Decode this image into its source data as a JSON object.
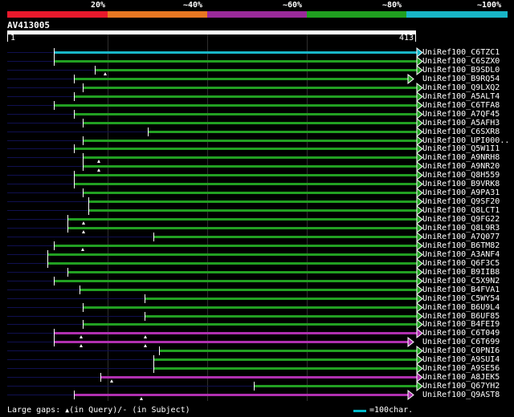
{
  "header": {
    "scale_labels": [
      "20%",
      "~40%",
      "~60%",
      "~80%",
      "~100%"
    ],
    "scale_colors": [
      "#e8192c",
      "#e87722",
      "#9b2a9b",
      "#20a020",
      "#18b6c8"
    ]
  },
  "query": {
    "name": "AV413005",
    "start": "1",
    "end": "413"
  },
  "colors": {
    "cyan": "#18b6c8",
    "green": "#22a022",
    "magenta": "#b030b0",
    "navy": "#101050",
    "white": "#ffffff"
  },
  "hits": [
    {
      "name": "UniRef100_C6TZC1",
      "color": "cyan",
      "start": 67,
      "end": 519,
      "markers": []
    },
    {
      "name": "UniRef100_C6SZX0",
      "color": "green",
      "start": 67,
      "end": 519,
      "markers": []
    },
    {
      "name": "UniRef100_B9SDL0",
      "color": "green",
      "start": 118,
      "end": 519,
      "markers": [
        131
      ]
    },
    {
      "name": "UniRef100_B9RQ54",
      "color": "green",
      "start": 92,
      "end": 508,
      "markers": []
    },
    {
      "name": "UniRef100_Q9LXQ2",
      "color": "green",
      "start": 103,
      "end": 519,
      "markers": []
    },
    {
      "name": "UniRef100_A5ALT4",
      "color": "green",
      "start": 92,
      "end": 519,
      "markers": []
    },
    {
      "name": "UniRef100_C6TFA8",
      "color": "green",
      "start": 67,
      "end": 519,
      "markers": []
    },
    {
      "name": "UniRef100_A7QF45",
      "color": "green",
      "start": 92,
      "end": 519,
      "markers": []
    },
    {
      "name": "UniRef100_A5AFH3",
      "color": "green",
      "start": 103,
      "end": 519,
      "markers": []
    },
    {
      "name": "UniRef100_C6SXR8",
      "color": "green",
      "start": 184,
      "end": 519,
      "markers": []
    },
    {
      "name": "UniRef100_UPI000..",
      "color": "green",
      "start": 103,
      "end": 519,
      "markers": []
    },
    {
      "name": "UniRef100_Q5W1I1",
      "color": "green",
      "start": 92,
      "end": 519,
      "markers": []
    },
    {
      "name": "UniRef100_A9NRH8",
      "color": "green",
      "start": 103,
      "end": 519,
      "markers": [
        123
      ]
    },
    {
      "name": "UniRef100_A9NR20",
      "color": "green",
      "start": 103,
      "end": 519,
      "markers": [
        123
      ]
    },
    {
      "name": "UniRef100_Q8H559",
      "color": "green",
      "start": 92,
      "end": 519,
      "markers": []
    },
    {
      "name": "UniRef100_B9VRK8",
      "color": "green",
      "start": 92,
      "end": 519,
      "markers": []
    },
    {
      "name": "UniRef100_A9PA31",
      "color": "green",
      "start": 103,
      "end": 519,
      "markers": []
    },
    {
      "name": "UniRef100_Q9SF20",
      "color": "green",
      "start": 110,
      "end": 519,
      "markers": []
    },
    {
      "name": "UniRef100_Q8LCT1",
      "color": "green",
      "start": 110,
      "end": 519,
      "markers": []
    },
    {
      "name": "UniRef100_Q9FG22",
      "color": "green",
      "start": 84,
      "end": 519,
      "markers": [
        104
      ]
    },
    {
      "name": "UniRef100_Q8L9R3",
      "color": "green",
      "start": 84,
      "end": 519,
      "markers": [
        104
      ]
    },
    {
      "name": "UniRef100_A7Q077",
      "color": "green",
      "start": 191,
      "end": 519,
      "markers": []
    },
    {
      "name": "UniRef100_B6TM82",
      "color": "green",
      "start": 67,
      "end": 519,
      "markers": [
        103
      ]
    },
    {
      "name": "UniRef100_A3ANF4",
      "color": "green",
      "start": 59,
      "end": 519,
      "markers": []
    },
    {
      "name": "UniRef100_Q6F3C5",
      "color": "green",
      "start": 59,
      "end": 519,
      "markers": []
    },
    {
      "name": "UniRef100_B9IIB8",
      "color": "green",
      "start": 84,
      "end": 519,
      "markers": []
    },
    {
      "name": "UniRef100_C5X9N2",
      "color": "green",
      "start": 67,
      "end": 519,
      "markers": []
    },
    {
      "name": "UniRef100_B4FVA1",
      "color": "green",
      "start": 99,
      "end": 519,
      "markers": []
    },
    {
      "name": "UniRef100_C5WY54",
      "color": "green",
      "start": 180,
      "end": 519,
      "markers": []
    },
    {
      "name": "UniRef100_B6U9L4",
      "color": "green",
      "start": 103,
      "end": 519,
      "markers": []
    },
    {
      "name": "UniRef100_B6UF85",
      "color": "green",
      "start": 180,
      "end": 519,
      "markers": []
    },
    {
      "name": "UniRef100_B4FEI9",
      "color": "green",
      "start": 103,
      "end": 519,
      "markers": []
    },
    {
      "name": "UniRef100_C6T049",
      "color": "magenta",
      "start": 67,
      "end": 519,
      "markers": [
        101,
        181
      ]
    },
    {
      "name": "UniRef100_C6T699",
      "color": "magenta",
      "start": 67,
      "end": 508,
      "markers": [
        101,
        181
      ]
    },
    {
      "name": "UniRef100_C0PNI6",
      "color": "green",
      "start": 198,
      "end": 519,
      "markers": []
    },
    {
      "name": "UniRef100_A9SUI4",
      "color": "green",
      "start": 191,
      "end": 519,
      "markers": []
    },
    {
      "name": "UniRef100_A9SE56",
      "color": "green",
      "start": 191,
      "end": 519,
      "markers": []
    },
    {
      "name": "UniRef100_A8JEK5",
      "color": "magenta",
      "start": 125,
      "end": 519,
      "markers": [
        139
      ]
    },
    {
      "name": "UniRef100_Q67YH2",
      "color": "green",
      "start": 316,
      "end": 519,
      "markers": []
    },
    {
      "name": "UniRef100_Q9AST8",
      "color": "magenta",
      "start": 92,
      "end": 508,
      "markers": [
        176
      ]
    }
  ],
  "footer": {
    "gaps_prefix": "Large gaps:",
    "gaps_query": "(in Query)/",
    "gaps_subject": "(in Subject)",
    "legend_text": "=100char."
  }
}
